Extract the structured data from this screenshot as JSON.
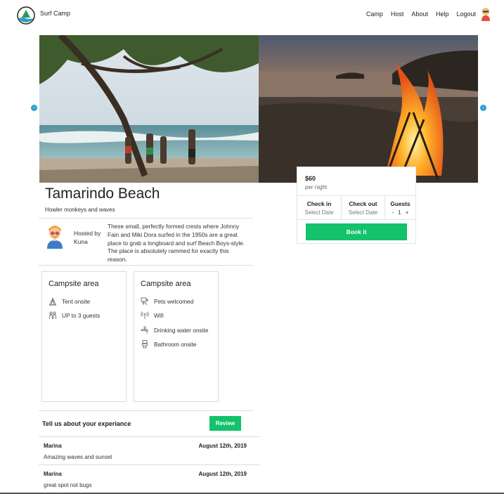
{
  "header": {
    "brand": "Surf Camp",
    "nav": [
      "Camp",
      "Host",
      "About",
      "Help",
      "Logout"
    ]
  },
  "carousel": {
    "prev_icon": "chevron-left-icon",
    "next_icon": "chevron-right-icon"
  },
  "listing": {
    "title": "Tamarindo Beach",
    "subtitle": "Howler monkeys and waves"
  },
  "host": {
    "hosted_by_label": "Hosted by",
    "name": "Kuna",
    "description": "These small, perfectly formed crests where Johnny Fain and Miki Dora surfed in the 1950s are a great place to grab a longboard and surf Beach Boys-style. The place is absolutely rammed for exactly this reason."
  },
  "amenities": [
    {
      "title": "Campsite area",
      "items": [
        {
          "icon": "tent-icon",
          "label": "Tent onsite"
        },
        {
          "icon": "guests-icon",
          "label": "UP to 3 guests"
        }
      ]
    },
    {
      "title": "Campsite area",
      "items": [
        {
          "icon": "pet-icon",
          "label": "Pets welcomed"
        },
        {
          "icon": "wifi-icon",
          "label": "Wifi"
        },
        {
          "icon": "water-tap-icon",
          "label": "Drinking water onsite"
        },
        {
          "icon": "toilet-icon",
          "label": "Bathroom onsite"
        }
      ]
    }
  ],
  "booking": {
    "price": "$60",
    "per_night": "per night",
    "check_in_label": "Check in",
    "check_in_value": "Select Date",
    "check_out_label": "Check out",
    "check_out_value": "Select Date",
    "guests_label": "Guests",
    "guests_minus": "-",
    "guests_count": "1",
    "guests_plus": "+",
    "book_label": "Book it"
  },
  "reviews": {
    "heading": "Tell us about your experiance",
    "button_label": "Review",
    "items": [
      {
        "name": "Marina",
        "date": "August 12th, 2019",
        "text": "Amazing waves and sunset"
      },
      {
        "name": "Marina",
        "date": "August 12th, 2019",
        "text": "great spot not bugs"
      }
    ]
  },
  "colors": {
    "accent_green": "#13c26b",
    "arrow_blue": "#2a9fd6"
  }
}
